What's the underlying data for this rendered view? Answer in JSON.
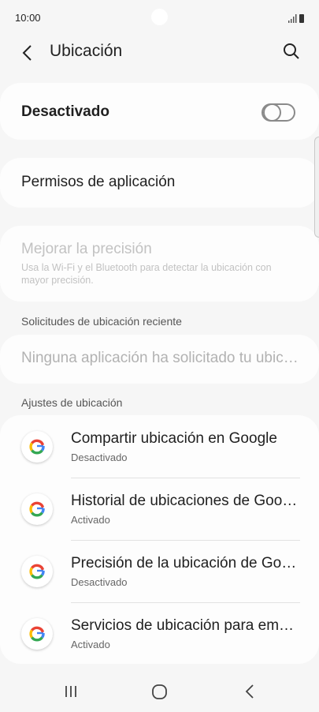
{
  "status_bar": {
    "time": "10:00"
  },
  "header": {
    "title": "Ubicación"
  },
  "master_toggle": {
    "label": "Desactivado",
    "state": "off"
  },
  "app_permissions": {
    "label": "Permisos de aplicación"
  },
  "improve_accuracy": {
    "title": "Mejorar la precisión",
    "subtitle": "Usa la Wi-Fi y el Bluetooth para detectar la ubicación con mayor precisión."
  },
  "recent_requests": {
    "header": "Solicitudes de ubicación reciente",
    "empty_text": "Ninguna aplicación ha solicitado tu ubicación recientemente"
  },
  "location_settings": {
    "header": "Ajustes de ubicación",
    "items": [
      {
        "title": "Compartir ubicación en Google",
        "status": "Desactivado",
        "icon": "google-icon"
      },
      {
        "title": "Historial de ubicaciones de Google",
        "status": "Activado",
        "icon": "google-icon"
      },
      {
        "title": "Precisión de la ubicación de Google",
        "status": "Desactivado",
        "icon": "google-icon"
      },
      {
        "title": "Servicios de ubicación para emergencias",
        "status": "Activado",
        "icon": "google-icon"
      }
    ]
  },
  "colors": {
    "background": "#f6f6f6",
    "card": "#fdfdfd",
    "disabled_text": "#c2c2c2"
  }
}
